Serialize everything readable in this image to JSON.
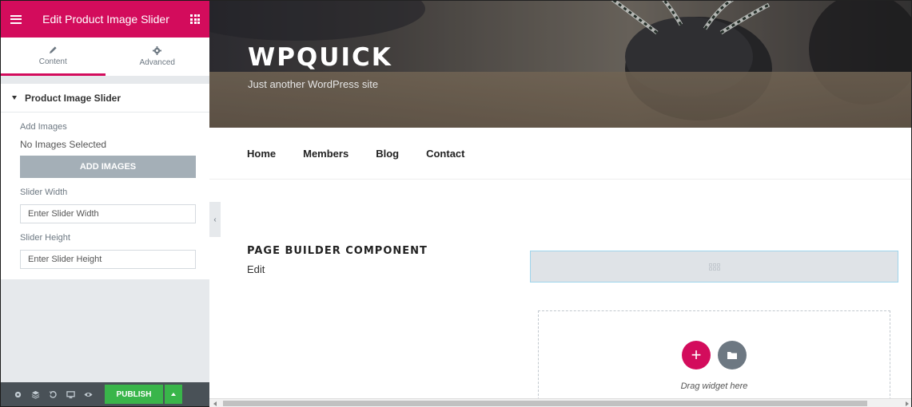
{
  "colors": {
    "accent": "#d30c5c",
    "publish": "#39b54a",
    "footer": "#495157",
    "button_gray": "#a4afb7",
    "placeholder_border": "#9ed5ec"
  },
  "panel": {
    "header": {
      "title": "Edit Product Image Slider",
      "menu_icon": "hamburger-icon",
      "widgets_icon": "grid-icon"
    },
    "tabs": [
      {
        "label": "Content",
        "icon": "pencil-icon",
        "active": true
      },
      {
        "label": "Advanced",
        "icon": "gear-icon",
        "active": false
      }
    ],
    "section": {
      "title": "Product Image Slider",
      "add_images": {
        "label": "Add Images",
        "status": "No Images Selected",
        "button": "ADD IMAGES"
      },
      "slider_width": {
        "label": "Slider Width",
        "placeholder": "Enter Slider Width"
      },
      "slider_height": {
        "label": "Slider Height",
        "placeholder": "Enter Slider Height"
      }
    },
    "footer": {
      "icons": [
        "settings-icon",
        "navigator-icon",
        "history-icon",
        "responsive-icon",
        "preview-icon"
      ],
      "publish_label": "PUBLISH"
    }
  },
  "site": {
    "title": "WPQUICK",
    "tagline": "Just another WordPress site",
    "nav": [
      "Home",
      "Members",
      "Blog",
      "Contact"
    ]
  },
  "content": {
    "component_title": "PAGE BUILDER COMPONENT",
    "component_text": "Edit",
    "drop_hint": "Drag widget here"
  }
}
